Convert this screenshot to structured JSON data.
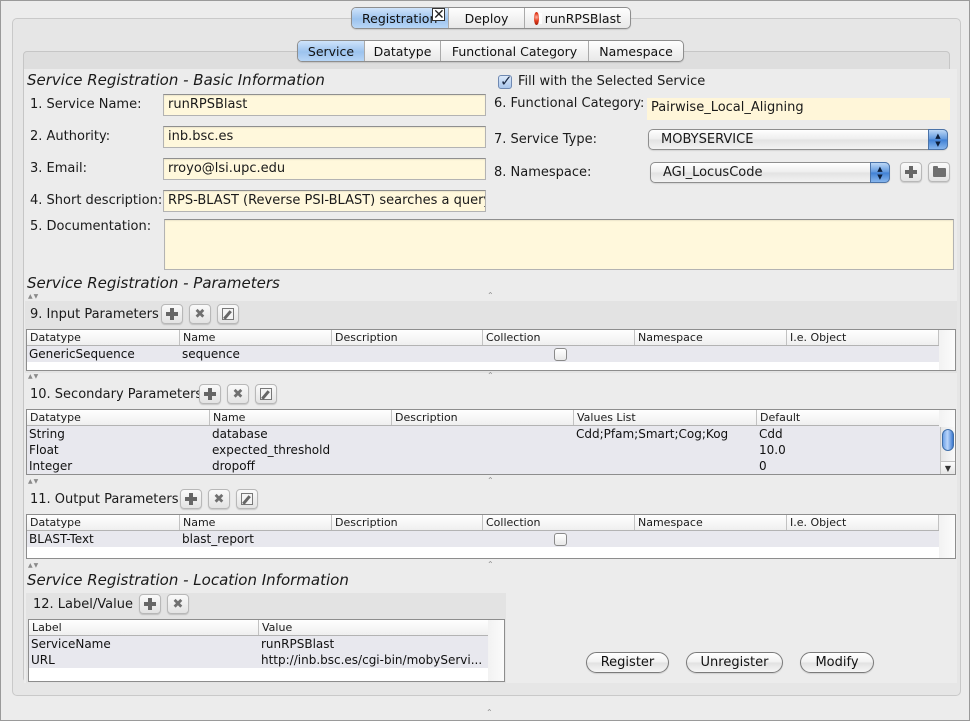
{
  "top_tabs": [
    {
      "label": "Registration",
      "active": true,
      "closable": true
    },
    {
      "label": "Deploy",
      "active": false
    },
    {
      "label": "runRPSBlast",
      "active": false,
      "icon": "service-icon"
    }
  ],
  "sub_tabs": [
    {
      "label": "Service",
      "active": true
    },
    {
      "label": "Datatype",
      "active": false
    },
    {
      "label": "Functional Category",
      "active": false
    },
    {
      "label": "Namespace",
      "active": false
    }
  ],
  "basic_info": {
    "title": "Service Registration - Basic Information",
    "service_name": {
      "label": "1. Service Name:",
      "value": "runRPSBlast"
    },
    "authority": {
      "label": "2. Authority:",
      "value": "inb.bsc.es"
    },
    "email": {
      "label": "3. Email:",
      "value": "rroyo@lsi.upc.edu"
    },
    "short_description": {
      "label": "4. Short description:",
      "value": "RPS-BLAST (Reverse PSI-BLAST) searches a query s"
    },
    "documentation": {
      "label": "5. Documentation:",
      "value": ""
    },
    "fill_selected": {
      "label": "Fill with the Selected Service",
      "checked": true
    },
    "functional_category": {
      "label": "6. Functional Category:",
      "value": "Pairwise_Local_Aligning"
    },
    "service_type": {
      "label": "7. Service Type:",
      "value": "MOBYSERVICE"
    },
    "namespace": {
      "label": "8. Namespace:",
      "value": "AGI_LocusCode"
    }
  },
  "parameters": {
    "title": "Service Registration - Parameters",
    "input": {
      "label": "9. Input Parameters",
      "columns": [
        "Datatype",
        "Name",
        "Description",
        "Collection",
        "Namespace",
        "I.e. Object"
      ],
      "rows": [
        {
          "datatype": "GenericSequence",
          "name": "sequence",
          "description": "",
          "collection": false,
          "namespace": "",
          "object": ""
        }
      ]
    },
    "secondary": {
      "label": "10. Secondary Parameters",
      "columns": [
        "Datatype",
        "Name",
        "Description",
        "Values List",
        "Default"
      ],
      "rows": [
        {
          "datatype": "String",
          "name": "database",
          "description": "",
          "values": "Cdd;Pfam;Smart;Cog;Kog",
          "default": "Cdd"
        },
        {
          "datatype": "Float",
          "name": "expected_threshold",
          "description": "",
          "values": "",
          "default": "10.0"
        },
        {
          "datatype": "Integer",
          "name": "dropoff",
          "description": "",
          "values": "",
          "default": "0"
        }
      ]
    },
    "output": {
      "label": "11. Output Parameters",
      "columns": [
        "Datatype",
        "Name",
        "Description",
        "Collection",
        "Namespace",
        "I.e. Object"
      ],
      "rows": [
        {
          "datatype": "BLAST-Text",
          "name": "blast_report",
          "description": "",
          "collection": false,
          "namespace": "",
          "object": ""
        }
      ]
    }
  },
  "location": {
    "title": "Service Registration - Location Information",
    "label_value": {
      "label": "12. Label/Value",
      "columns": [
        "Label",
        "Value"
      ],
      "rows": [
        {
          "label": "ServiceName",
          "value": "runRPSBlast"
        },
        {
          "label": "URL",
          "value": "http://inb.bsc.es/cgi-bin/mobyServi..."
        }
      ]
    }
  },
  "actions": {
    "register": "Register",
    "unregister": "Unregister",
    "modify": "Modify"
  },
  "colors": {
    "field_bg": "#fff8dc",
    "active_tab": "#9cc3ee",
    "row_stripe": "#e8e8ee"
  }
}
